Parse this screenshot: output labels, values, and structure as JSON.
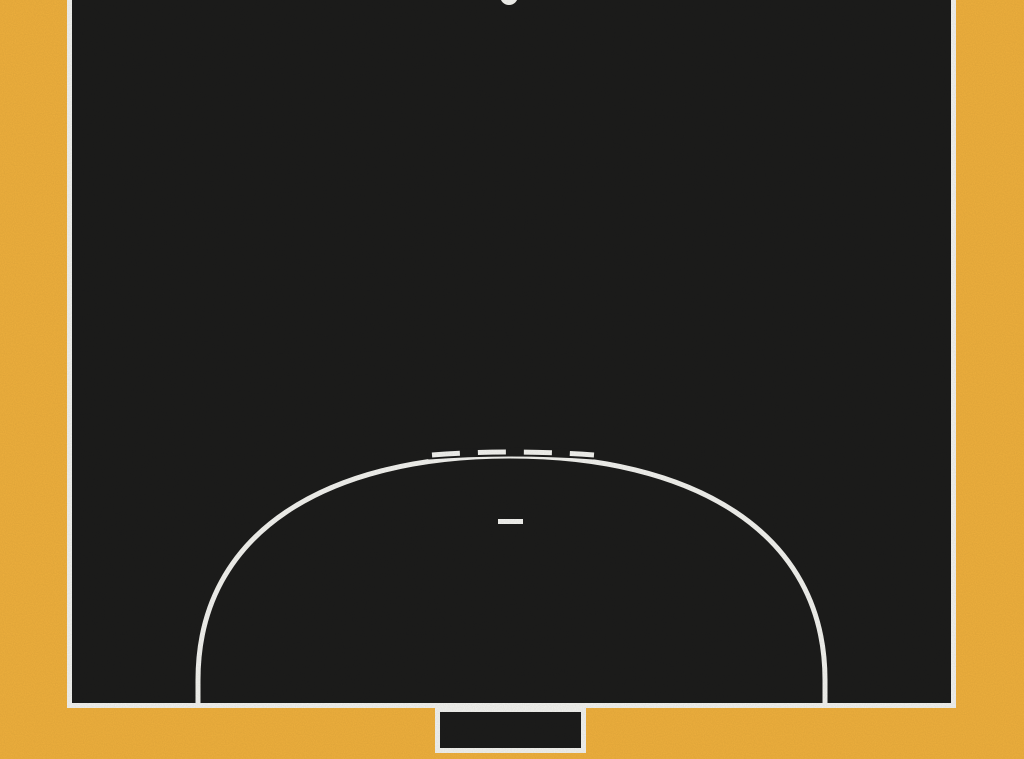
{
  "court": {
    "sport": "handball",
    "view": "half-court",
    "surround_color": "#EFB03D",
    "playing_surface_color": "#1C1C1B",
    "line_color": "#F2F2EE",
    "elements": [
      {
        "name": "sideline-left"
      },
      {
        "name": "sideline-right"
      },
      {
        "name": "goal-line"
      },
      {
        "name": "center-circle-dot"
      },
      {
        "name": "goal-area-line",
        "style": "solid"
      },
      {
        "name": "free-throw-line",
        "style": "dashed"
      },
      {
        "name": "penalty-mark"
      },
      {
        "name": "goal",
        "fill": "#1C1C1B"
      }
    ]
  }
}
